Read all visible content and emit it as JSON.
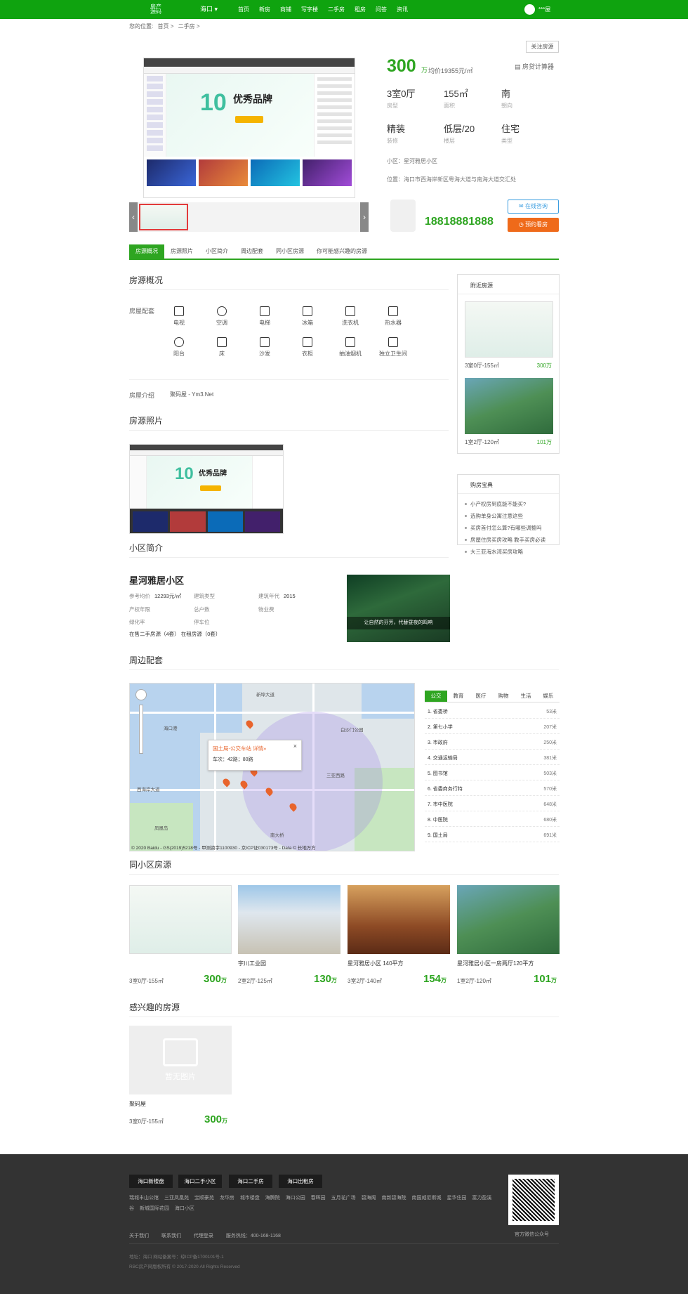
{
  "header": {
    "logo_line1": "房产",
    "logo_line2": "源码",
    "city": "海口 ▾",
    "nav": [
      "首页",
      "新房",
      "商铺",
      "写字楼",
      "二手房",
      "租房",
      "问答",
      "资讯"
    ],
    "user": "***屋"
  },
  "breadcrumb": [
    "您的位置:",
    "首页 >",
    "二手房 >"
  ],
  "follow_label": "关注房源",
  "listing": {
    "price": "300",
    "price_unit": "万",
    "avg_price": "均价19355元/㎡",
    "calculator": "房贷计算器",
    "facts": [
      {
        "value": "3室0厅",
        "label": "房型"
      },
      {
        "value": "155㎡",
        "label": "面积"
      },
      {
        "value": "南",
        "label": "朝向"
      },
      {
        "value": "精装",
        "label": "装修"
      },
      {
        "value": "低层/20",
        "label": "楼层"
      },
      {
        "value": "住宅",
        "label": "类型"
      }
    ],
    "district": "小区：星河雅居小区",
    "address": "位置：海口市西海岸新区粤海大道与南海大道交汇处",
    "phone": "18818881888",
    "consult_btn": "在线咨询",
    "order_btn": "预约看房"
  },
  "gallery": {
    "prev": "‹",
    "next": "›",
    "shot_ten": "10",
    "shot_brand": "优秀品牌"
  },
  "tabs": [
    "房源概况",
    "房源照片",
    "小区简介",
    "周边配套",
    "同小区房源",
    "你可能感兴趣的房源"
  ],
  "overview": {
    "title": "房源概况",
    "facilities_label": "房屋配套",
    "facilities": [
      "电视",
      "空调",
      "电梯",
      "冰箱",
      "洗衣机",
      "热水器",
      "阳台",
      "床",
      "沙发",
      "衣柜",
      "抽油烟机",
      "独立卫生间"
    ],
    "intro_label": "房屋介绍",
    "intro_text": "聚码屋 - Ym3.Net"
  },
  "photos": {
    "title": "房源照片"
  },
  "side": {
    "nearby_title": "附近房源",
    "nearby": [
      {
        "spec": "3室0厅-155㎡",
        "price": "300万"
      },
      {
        "spec": "1室2厅-120㎡",
        "price": "101万"
      }
    ],
    "tips_title": "购房宝典",
    "tips": [
      "小产权房到底能不能买?",
      "选购单身公寓注意这些",
      "买房首付怎么算?有哪些调整吗",
      "房屋住房买房攻略 教手买房必读",
      "大三亚海水湾买房攻略"
    ]
  },
  "community": {
    "title": "小区简介",
    "name": "星河雅居小区",
    "rows": [
      [
        {
          "k": "参考均价",
          "v": "12293元/㎡"
        },
        {
          "k": "建筑类型",
          "v": ""
        },
        {
          "k": "建筑年代",
          "v": "2015"
        }
      ],
      [
        {
          "k": "产权年限",
          "v": ""
        },
        {
          "k": "总户数",
          "v": ""
        },
        {
          "k": "物业费",
          "v": ""
        }
      ],
      [
        {
          "k": "绿化率",
          "v": ""
        },
        {
          "k": "停车位",
          "v": ""
        },
        {
          "k": "",
          "v": ""
        }
      ]
    ],
    "stock": "在售二手房源（4套）  在租房源（0套）",
    "img_caption": "让自然的芬芳，代替昼夜的鸣响"
  },
  "surroundings": {
    "title": "周边配套",
    "map_popup_title": "国土局-公交车站 详情»",
    "map_popup_desc": "车次：42路；80路",
    "map_footer": "© 2020 Baidu - GS(2019)5218号 - 甲测资字1100930 - 京ICP证030173号 - Data © 长地万方",
    "map_labels": [
      "新埠大道",
      "海口港",
      "白沙门公园",
      "三亚西路",
      "西海岸大道",
      "凤凰岛",
      "南大桥"
    ],
    "poi_tabs": [
      "公交",
      "教育",
      "医疗",
      "购物",
      "生活",
      "娱乐"
    ],
    "pois": [
      {
        "name": "1. 省委桥",
        "dist": "53米"
      },
      {
        "name": "2. 第七小学",
        "dist": "207米"
      },
      {
        "name": "3. 市政府",
        "dist": "250米"
      },
      {
        "name": "4. 交通运输局",
        "dist": "381米"
      },
      {
        "name": "5. 图书馆",
        "dist": "503米"
      },
      {
        "name": "6. 省委商务行特",
        "dist": "570米"
      },
      {
        "name": "7. 市中医院",
        "dist": "648米"
      },
      {
        "name": "8. 中医院",
        "dist": "680米"
      },
      {
        "name": "9. 国土局",
        "dist": "691米"
      }
    ]
  },
  "same_community": {
    "title": "同小区房源",
    "cards": [
      {
        "title": "",
        "spec": "3室0厅-155㎡",
        "price": "300",
        "unit": "万"
      },
      {
        "title": "宇川工业园",
        "spec": "2室2厅-125㎡",
        "price": "130",
        "unit": "万"
      },
      {
        "title": "星河雅居小区 140平方",
        "spec": "3室2厅-140㎡",
        "price": "154",
        "unit": "万"
      },
      {
        "title": "星河雅居小区一房两厅120平方",
        "spec": "1室2厅-120㎡",
        "price": "101",
        "unit": "万"
      }
    ]
  },
  "interest": {
    "title": "感兴趣的房源",
    "noimg": "暂无图片",
    "card": {
      "title": "聚码屋",
      "spec": "3室0厅-155㎡",
      "price": "300",
      "unit": "万"
    }
  },
  "footer": {
    "tags": [
      "海口新楼盘",
      "海口二手小区",
      "海口二手房",
      "海口出租房"
    ],
    "links": [
      "瑞城丰山公馆",
      "三亚凤凰苑",
      "宝顺豪苑",
      "龙华房",
      "城市楼盘",
      "海腾院",
      "海口公园",
      "春晖园",
      "五月花广场",
      "碧海阁",
      "南新碧海院",
      "南国威尼斯城",
      "星华住园",
      "富力盈溪谷",
      "新城国际花园",
      "海口小区"
    ],
    "bottom": [
      "关于我们",
      "联系我们",
      "代理登录",
      "服务热线：400-168-1168"
    ],
    "qr_label": "官方微信公众号",
    "copy1": "地址：海口 网站备案号：琼ICP备1700101号-1",
    "copy2": "RBC房产网版权所有 © 2017-2020 All Rights Reserved"
  }
}
